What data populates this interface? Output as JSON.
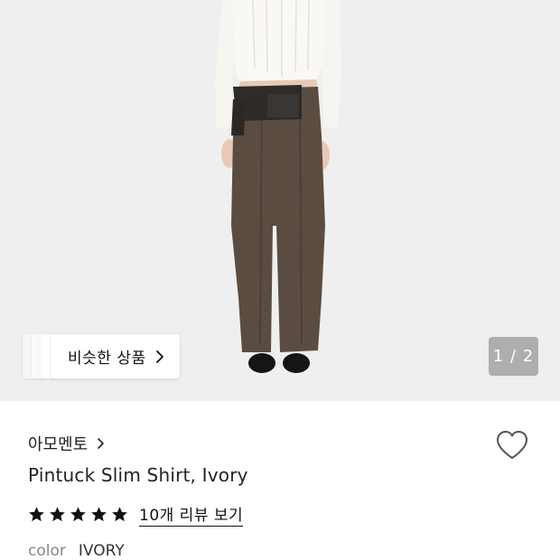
{
  "gallery": {
    "image_alt": "Pintuck Slim Shirt, Ivory product photo",
    "similar_button_label": "비슷한 상품",
    "pager_text": "1 / 2"
  },
  "product": {
    "brand": "아모멘토",
    "name": "Pintuck Slim Shirt, Ivory",
    "rating": 5,
    "rating_max": 5,
    "review_link": "10개 리뷰 보기",
    "color_label": "color",
    "color_value": "IVORY"
  },
  "icons": {
    "similar": "chevron-right-icon",
    "brand": "chevron-right-icon",
    "like": "heart-outline-icon",
    "star": "star-filled-icon"
  },
  "colors": {
    "gallery_bg": "#efefef",
    "star": "#111111",
    "muted_text": "#888888"
  }
}
